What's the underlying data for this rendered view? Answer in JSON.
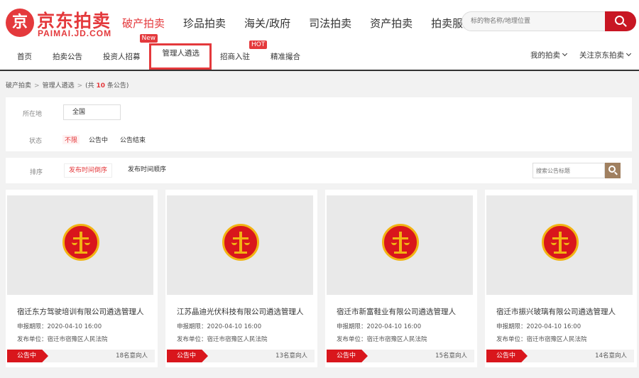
{
  "logo": {
    "glyph": "京",
    "title": "京东拍卖",
    "subtitle": "PAIMAI.JD.COM"
  },
  "main_nav": [
    "破产拍卖",
    "珍品拍卖",
    "海关/政府",
    "司法拍卖",
    "资产拍卖",
    "拍卖服务"
  ],
  "search": {
    "placeholder": "标的物名称/地理位置"
  },
  "sub_nav": [
    {
      "label": "首页"
    },
    {
      "label": "拍卖公告"
    },
    {
      "label": "投资人招募"
    },
    {
      "label": "管理人遴选",
      "badge": "New"
    },
    {
      "label": "招商入驻",
      "badge": "HOT"
    },
    {
      "label": "精准撮合"
    }
  ],
  "right_links": [
    "我的拍卖",
    "关注京东拍卖"
  ],
  "breadcrumb": {
    "root": "破产拍卖",
    "current": "管理人遴选",
    "count_prefix": "(共",
    "count": "10",
    "count_suffix": "条公告)"
  },
  "filter": {
    "location_label": "所在地",
    "location_value": "全国",
    "status_label": "状态",
    "status_options": [
      "不限",
      "公告中",
      "公告结束"
    ]
  },
  "sort": {
    "label": "排序",
    "options": [
      "发布时间倒序",
      "发布时间顺序"
    ],
    "search_placeholder": "搜索公告标题"
  },
  "cards": [
    {
      "title": "宿迁东方驾驶培训有限公司遴选管理人",
      "deadline_label": "申报期限：",
      "deadline": "2020-04-10 16:00",
      "publisher_label": "发布单位：",
      "publisher": "宿迁市宿豫区人民法院",
      "status": "公告中",
      "count": "18名意向人"
    },
    {
      "title": "江苏晶迪光伏科技有限公司遴选管理人",
      "deadline_label": "申报期限：",
      "deadline": "2020-04-10 16:00",
      "publisher_label": "发布单位：",
      "publisher": "宿迁市宿豫区人民法院",
      "status": "公告中",
      "count": "13名意向人"
    },
    {
      "title": "宿迁市新富鞋业有限公司遴选管理人",
      "deadline_label": "申报期限：",
      "deadline": "2020-04-10 16:00",
      "publisher_label": "发布单位：",
      "publisher": "宿迁市宿豫区人民法院",
      "status": "公告中",
      "count": "15名意向人"
    },
    {
      "title": "宿迁市振兴玻璃有限公司遴选管理人",
      "deadline_label": "申报期限：",
      "deadline": "2020-04-10 16:00",
      "publisher_label": "发布单位：",
      "publisher": "宿迁市宿豫区人民法院",
      "status": "公告中",
      "count": "14名意向人"
    }
  ],
  "colors": {
    "brand_red": "#e4393c",
    "emblem_gold": "#f2b413"
  }
}
